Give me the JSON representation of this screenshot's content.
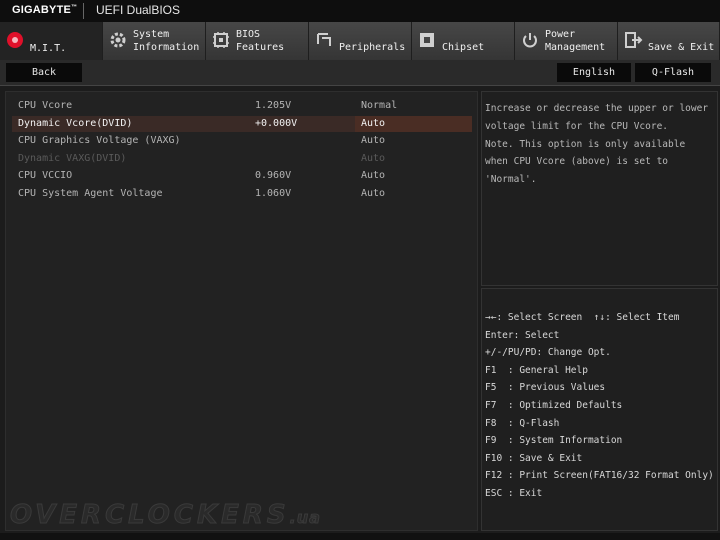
{
  "header": {
    "brand": "GIGABYTE",
    "brand_tm": "™",
    "product": "UEFI DualBIOS"
  },
  "tabs": [
    {
      "label": "M.I.T.",
      "icon": "mit-icon",
      "active": true
    },
    {
      "label": "System\nInformation",
      "icon": "gear-icon"
    },
    {
      "label": "BIOS\nFeatures",
      "icon": "chip-grid-icon"
    },
    {
      "label": "Peripherals",
      "icon": "plug-icon"
    },
    {
      "label": "Chipset",
      "icon": "chip-icon"
    },
    {
      "label": "Power\nManagement",
      "icon": "power-icon"
    },
    {
      "label": "Save & Exit",
      "icon": "exit-icon"
    }
  ],
  "subbar": {
    "back_label": "Back",
    "language_label": "English",
    "qflash_label": "Q-Flash"
  },
  "settings": [
    {
      "name": "CPU Vcore",
      "value": "1.205V",
      "option": "Normal"
    },
    {
      "name": "Dynamic Vcore(DVID)",
      "value": "+0.000V",
      "option": "Auto",
      "selected": true
    },
    {
      "name": "CPU Graphics Voltage (VAXG)",
      "value": "",
      "option": "Auto"
    },
    {
      "name": "Dynamic VAXG(DVID)",
      "value": "",
      "option": "Auto",
      "disabled": true
    },
    {
      "name": "CPU VCCIO",
      "value": "0.960V",
      "option": "Auto"
    },
    {
      "name": "CPU System Agent Voltage",
      "value": "1.060V",
      "option": "Auto"
    }
  ],
  "help_lines": [
    "Increase or decrease the upper or lower",
    "voltage limit for the CPU Vcore.",
    "Note. This option is only available",
    "when CPU Vcore (above) is set to",
    "'Normal'."
  ],
  "keys": [
    "→←: Select Screen  ↑↓: Select Item",
    "Enter: Select",
    "+/-/PU/PD: Change Opt.",
    "F1  : General Help",
    "F5  : Previous Values",
    "F7  : Optimized Defaults",
    "F8  : Q-Flash",
    "F9  : System Information",
    "F10 : Save & Exit",
    "F12 : Print Screen(FAT16/32 Format Only)",
    "ESC : Exit"
  ],
  "watermark": {
    "main": "OVERCLOCKERS",
    "suffix": ".ua"
  },
  "colors": {
    "accent": "#e0102a",
    "selected_row": "#3a2a26"
  }
}
